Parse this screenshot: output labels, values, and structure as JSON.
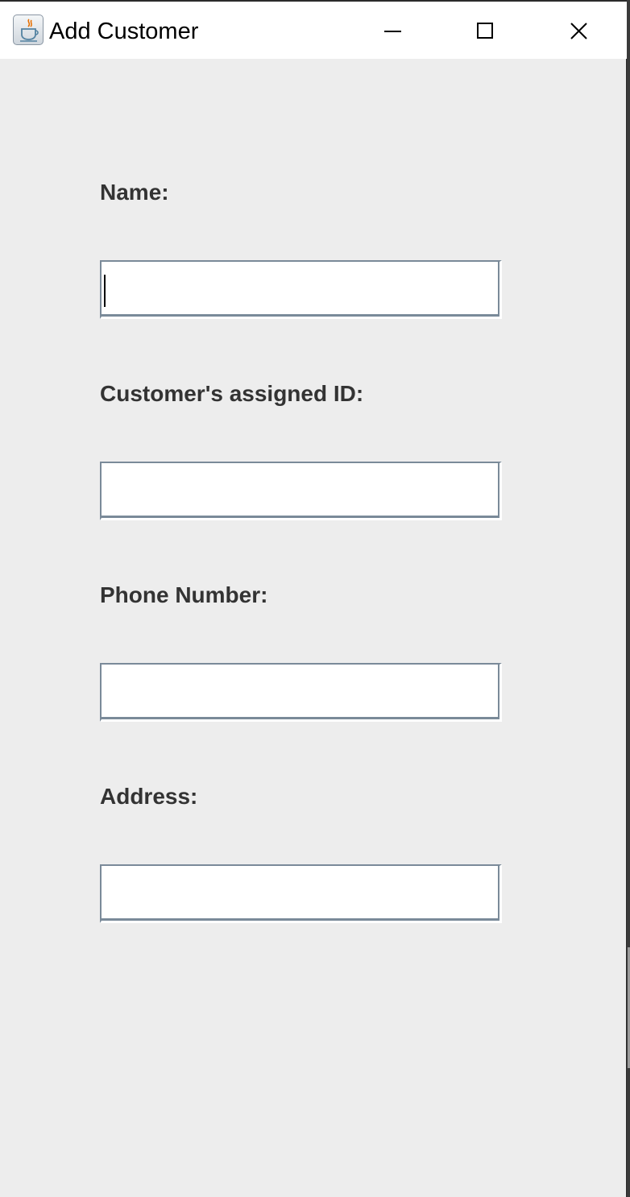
{
  "window": {
    "title": "Add Customer",
    "icon": "java-coffee-cup-icon",
    "controls": [
      "minimize-icon",
      "maximize-icon",
      "close-icon"
    ]
  },
  "form": {
    "fields": [
      {
        "label": "Name:",
        "value": "",
        "focused": true
      },
      {
        "label": "Customer's assigned ID:",
        "value": ""
      },
      {
        "label": "Phone Number:",
        "value": ""
      },
      {
        "label": "Address:",
        "value": ""
      }
    ]
  },
  "colors": {
    "window_background": "#ededed",
    "titlebar_background": "#ffffff",
    "label_text": "#333333",
    "input_border": "#7a8a99"
  }
}
